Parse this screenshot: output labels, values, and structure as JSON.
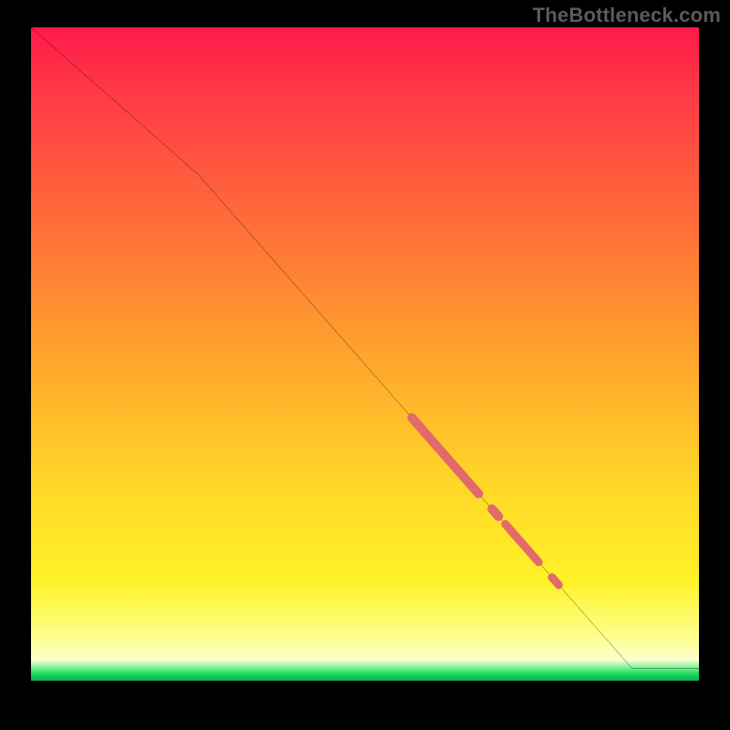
{
  "attribution": "TheBottleneck.com",
  "colors": {
    "marker": "#e26a6a",
    "line": "#000000",
    "gradient_top": "#ff1a4b",
    "gradient_mid": "#ffd328",
    "gradient_low": "#feffd0",
    "green_band": "#16c95b",
    "background": "#000000"
  },
  "chart_data": {
    "type": "line",
    "title": "",
    "xlabel": "",
    "ylabel": "",
    "xlim": [
      0,
      100
    ],
    "ylim": [
      0,
      100
    ],
    "grid": false,
    "legend": false,
    "series": [
      {
        "name": "curve",
        "x": [
          0,
          25,
          90,
          100
        ],
        "y": [
          100,
          78,
          4,
          4
        ]
      }
    ],
    "markers": [
      {
        "name": "thick-segment",
        "x0": 57,
        "x1": 67,
        "width": 10
      },
      {
        "name": "dot-1",
        "x0": 69,
        "x1": 70,
        "width": 10
      },
      {
        "name": "short-segment",
        "x0": 71,
        "x1": 76,
        "width": 9
      },
      {
        "name": "dot-2",
        "x0": 78,
        "x1": 79,
        "width": 9
      }
    ]
  }
}
